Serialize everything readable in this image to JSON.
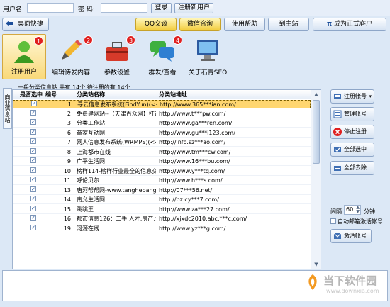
{
  "login": {
    "user_label": "用户名:",
    "pwd_label": "密 码:",
    "login_btn": "登录",
    "register_btn": "注册新用户"
  },
  "toolbar": {
    "desktop_btn": "桌面快捷",
    "qq_btn": "QQ交谈",
    "wechat_btn": "微信咨询",
    "help_btn": "使用帮助",
    "site_btn": "到主站",
    "member_btn": "成为正式客户"
  },
  "nav": [
    {
      "label": "注册用户",
      "badge": "1"
    },
    {
      "label": "编辑待发内容",
      "badge": "2"
    },
    {
      "label": "参数设置",
      "badge": "3"
    },
    {
      "label": "群发/查看",
      "badge": "4"
    },
    {
      "label": "关于石青SEO",
      "badge": ""
    }
  ],
  "side_tab": "商业信息站",
  "info_line": "一般分类信息站 共有 14个 待注册的有 14个",
  "columns": {
    "check": "是否选中",
    "num": "编号",
    "name": "分类站名称",
    "url": "分类站地址"
  },
  "rows": [
    {
      "num": "1",
      "name": "寻云信息发布系统(FindYun)(<<最",
      "url": "http://www.365***ian.com/"
    },
    {
      "num": "2",
      "name": "免费建网站--【天津百众网】打造",
      "url": "http://www.t***pw.com/"
    },
    {
      "num": "3",
      "name": "分类工作站",
      "url": "http://www.ga***ren.com/"
    },
    {
      "num": "6",
      "name": "商家互动网",
      "url": "http://www.gu***i123.com/"
    },
    {
      "num": "7",
      "name": "网人信息发布系统(WRMPS)(<<最化",
      "url": "http://info.sz***ao.com/"
    },
    {
      "num": "8",
      "name": "上海都市在线",
      "url": "http://www.tm***cw.com/"
    },
    {
      "num": "9",
      "name": "广平生活网",
      "url": "http://www.16***bu.com/"
    },
    {
      "num": "10",
      "name": "榜样114-榜样行业最全的信息交流",
      "url": "http://www.y***tq.com/"
    },
    {
      "num": "11",
      "name": "呼伦贝尔",
      "url": "http://www.h***s.com/"
    },
    {
      "num": "13",
      "name": "唐河帮帮网-www.tanghebangbang",
      "url": "http://07***56.net/"
    },
    {
      "num": "14",
      "name": "南允生活网",
      "url": "http://bz.cy***7.com/"
    },
    {
      "num": "15",
      "name": "跳跳王",
      "url": "http://www.za***27.com/"
    },
    {
      "num": "16",
      "name": "都市信息126：二手,人才,房产,免费",
      "url": "http://xjxdc2010.abc.***c.com/"
    },
    {
      "num": "19",
      "name": "河源在线",
      "url": "http://www.yz***g.com/"
    }
  ],
  "right": {
    "reg_account_btn": "注册帐号",
    "manage_btn": "管理帐号",
    "stop_btn": "停止注册",
    "select_all_btn": "全部选中",
    "deselect_all_btn": "全部去除",
    "interval_label": "间隔",
    "interval_value": "60",
    "minute_label": "分钟",
    "auto_activate_label": "自动邮箱激活帐号",
    "activate_btn": "激活帐号"
  },
  "watermark": {
    "cn": "当下软件园",
    "en": "www.downxia.com"
  },
  "colors": {
    "accent": "#3f6fb4",
    "selected_row": "#ffd670",
    "badge": "#e02020"
  }
}
